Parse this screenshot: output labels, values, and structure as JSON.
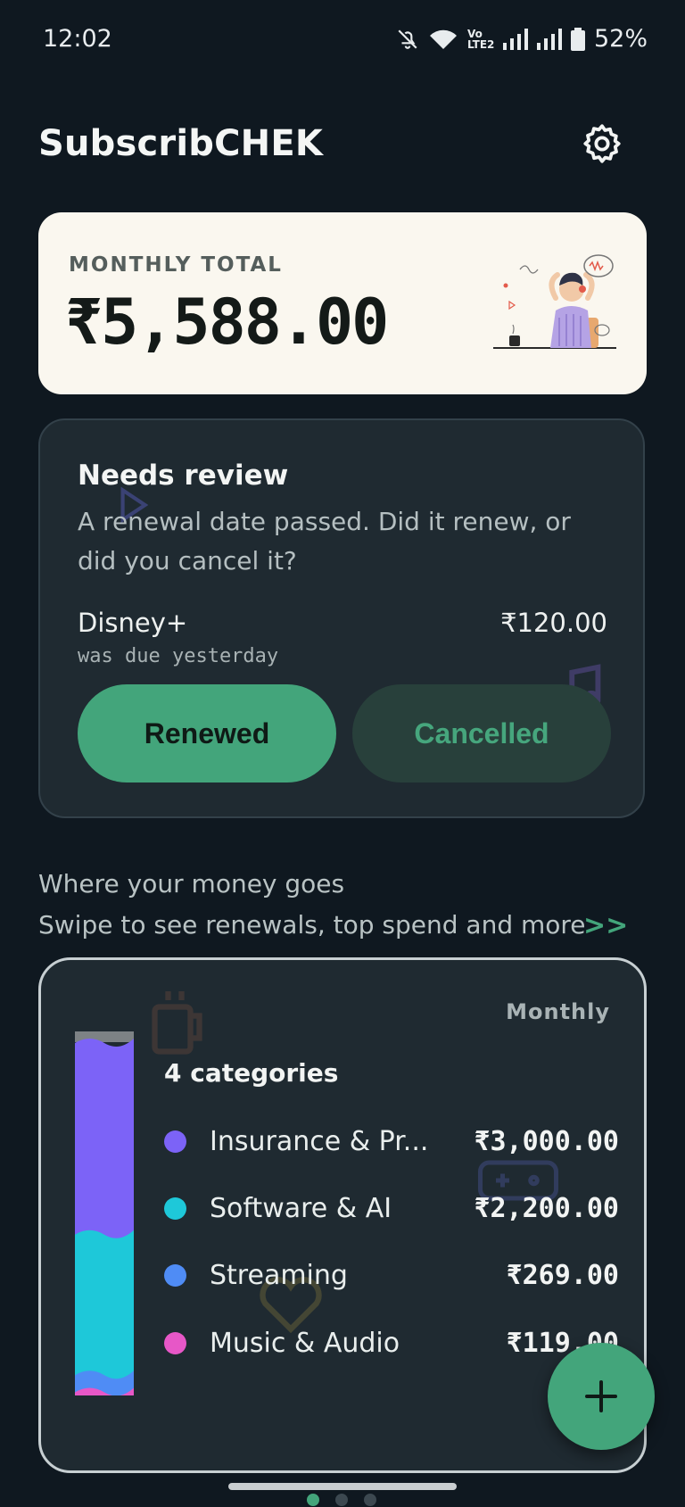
{
  "status_bar": {
    "time": "12:02",
    "network_label": "Vo LTE2",
    "battery": "52%"
  },
  "app": {
    "title": "SubscribCHEK"
  },
  "icons": {
    "settings": "gear-icon",
    "add": "plus-icon"
  },
  "summary": {
    "label": "MONTHLY TOTAL",
    "amount": "₹5,588.00"
  },
  "review": {
    "title": "Needs review",
    "description": "A renewal date passed. Did it renew, or did you cancel it?",
    "subscription": {
      "name": "Disney+",
      "price": "₹120.00",
      "due": "was due yesterday"
    },
    "renewed_label": "Renewed",
    "cancelled_label": "Cancelled"
  },
  "breakdown": {
    "heading": "Where your money goes",
    "swipe_hint": "Swipe to see renewals, top spend and more",
    "swipe_arrows": ">>",
    "period": "Monthly",
    "count_label": "4 categories",
    "categories": [
      {
        "name": "Insurance & Pr...",
        "amount": "₹3,000.00",
        "value": 3000,
        "color": "#7c63f7"
      },
      {
        "name": "Software & AI",
        "amount": "₹2,200.00",
        "value": 2200,
        "color": "#1ec8d9"
      },
      {
        "name": "Streaming",
        "amount": "₹269.00",
        "value": 269,
        "color": "#4f8cf5"
      },
      {
        "name": "Music & Audio",
        "amount": "₹119.00",
        "value": 119,
        "color": "#e757c7"
      }
    ]
  },
  "pager": {
    "pages": 3,
    "active": 0
  },
  "colors": {
    "accent": "#43a57b",
    "background": "#0f1820",
    "card": "#1f2a31"
  }
}
